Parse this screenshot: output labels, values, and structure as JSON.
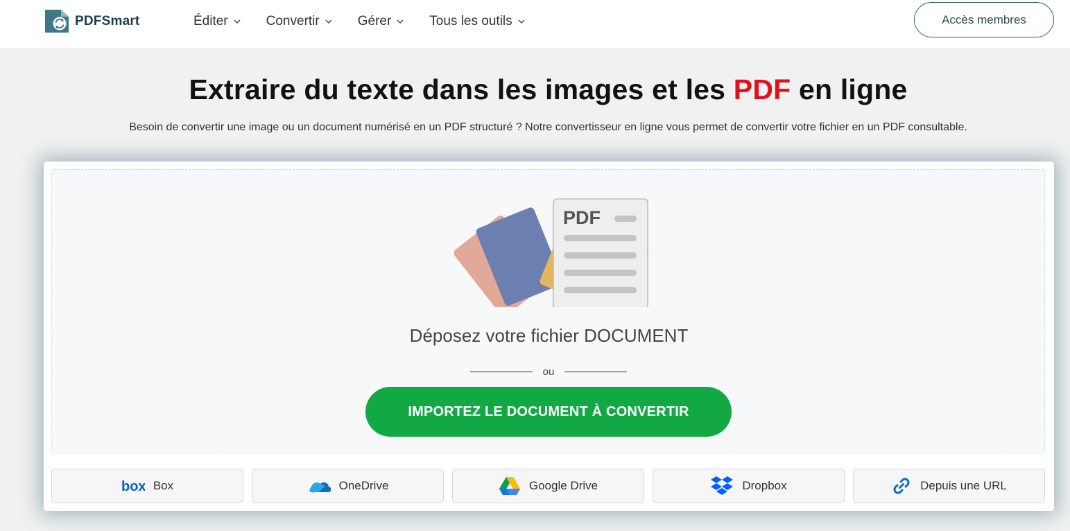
{
  "header": {
    "logo_text": "PDFSmart",
    "nav": [
      {
        "label": "Éditer"
      },
      {
        "label": "Convertir"
      },
      {
        "label": "Gérer"
      },
      {
        "label": "Tous les outils"
      }
    ],
    "member_label": "Accès membres"
  },
  "hero": {
    "title_part1": "Extraire du texte dans les images et les ",
    "title_accent": "PDF",
    "title_part2": " en ligne",
    "subtitle": "Besoin de convertir une image ou un document numérisé en un PDF structuré ? Notre convertisseur en ligne vous permet de convertir votre fichier en un PDF consultable."
  },
  "upload": {
    "doc_label": "PDF",
    "drop_text": "Déposez votre fichier DOCUMENT",
    "or": "ou",
    "import_label": "IMPORTEZ LE DOCUMENT À CONVERTIR"
  },
  "sources": [
    {
      "label": "Box",
      "icon": "box-icon"
    },
    {
      "label": "OneDrive",
      "icon": "onedrive-icon"
    },
    {
      "label": "Google Drive",
      "icon": "google-drive-icon"
    },
    {
      "label": "Dropbox",
      "icon": "dropbox-icon"
    },
    {
      "label": "Depuis une URL",
      "icon": "link-icon"
    }
  ],
  "colors": {
    "accent_red": "#e0111b",
    "import_green": "#12a844",
    "brand_teal": "#2f5b6b"
  }
}
